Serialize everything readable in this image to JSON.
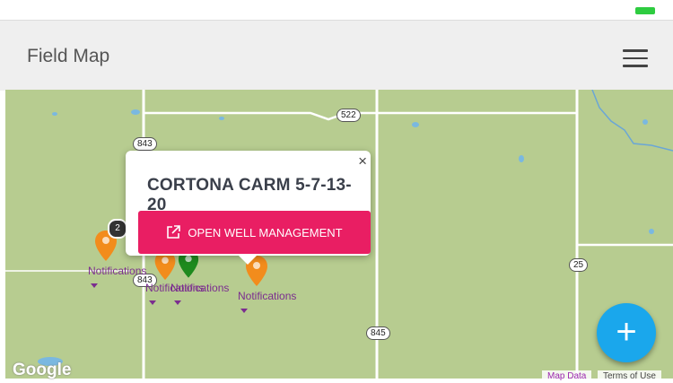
{
  "app": {
    "title": "Field Map"
  },
  "menu": {
    "icon": "hamburger-menu-icon"
  },
  "map": {
    "roads": {
      "r522": "522",
      "r843a": "843",
      "r843b": "843",
      "r25": "25",
      "r845": "845"
    },
    "markers": [
      {
        "label": "Notifications",
        "color": "#f28c1c"
      },
      {
        "label": "Notifications",
        "color": "#f28c1c"
      },
      {
        "label": "Notifications",
        "color": "#1e8a1e"
      },
      {
        "label": "Notifications",
        "color": "#f28c1c"
      }
    ],
    "cluster_count": "2",
    "google": "Google",
    "attribution": {
      "map_data": "Map Data",
      "terms": "Terms of Use"
    }
  },
  "popup": {
    "title": "CORTONA CARM 5-7-13-20",
    "button": "OPEN WELL MANAGEMENT",
    "close": "×"
  },
  "fab": {
    "label": "+"
  },
  "colors": {
    "accent": "#e91e63",
    "fab": "#1aa7ec",
    "map": "#b7cc90"
  }
}
